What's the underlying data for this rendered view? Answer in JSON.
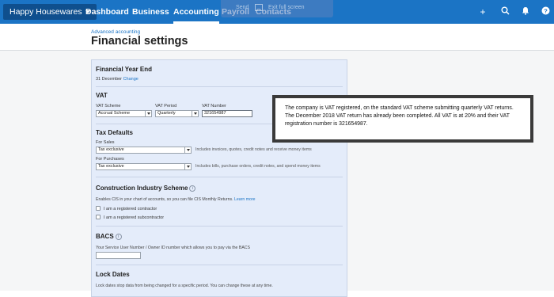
{
  "topbar": {
    "org_name": "Happy Housewares",
    "nav": [
      "Dashboard",
      "Business",
      "Accounting",
      "Payroll",
      "Contacts"
    ],
    "active_nav": "Accounting",
    "overlay_left": "Send",
    "overlay_right": "Exit full screen",
    "icons": [
      "plus-icon",
      "search-icon",
      "bell-icon",
      "help-icon"
    ]
  },
  "header": {
    "breadcrumb": "Advanced accounting",
    "title": "Financial settings"
  },
  "financial_year": {
    "heading": "Financial Year End",
    "value": "31 December",
    "change_link": "Change"
  },
  "vat": {
    "heading": "VAT",
    "scheme_label": "VAT Scheme",
    "scheme_value": "Accrual Scheme",
    "period_label": "VAT Period",
    "period_value": "Quarterly",
    "number_label": "VAT Number",
    "number_value": "321654987"
  },
  "tax_defaults": {
    "heading": "Tax Defaults",
    "sales_label": "For Sales",
    "sales_value": "Tax exclusive",
    "sales_hint": "Includes invoices, quotes, credit notes and receive money items",
    "purchases_label": "For Purchases",
    "purchases_value": "Tax exclusive",
    "purchases_hint": "Includes bills, purchase orders, credit notes, and spend money items"
  },
  "cis": {
    "heading": "Construction Industry Scheme",
    "description": "Enables CIS in your chart of accounts, so you can file CIS Monthly Returns.",
    "learn_more": "Learn more",
    "contractor_label": "I am a registered contractor",
    "subcontractor_label": "I am a registered subcontractor"
  },
  "bacs": {
    "heading": "BACS",
    "description": "Your Service User Number / Owner ID number which allows you to pay via the BACS",
    "value": ""
  },
  "lock_dates": {
    "heading": "Lock Dates",
    "description": "Lock dates stop data from being changed for a specific period. You can change these at any time."
  },
  "annotation": {
    "text": "The company is VAT registered, on the standard VAT scheme submitting quarterly VAT returns. The December 2018 VAT return has already been completed. All VAT is at 20% and their VAT registration number is 321654987."
  }
}
